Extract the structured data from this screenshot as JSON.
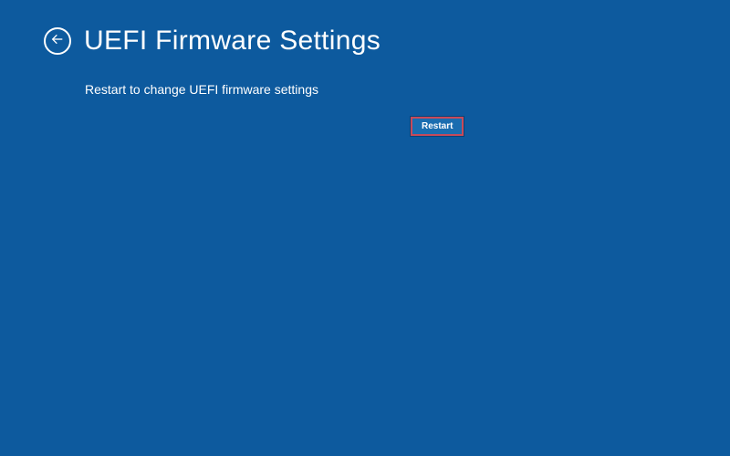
{
  "header": {
    "title": "UEFI Firmware Settings"
  },
  "main": {
    "description": "Restart to change UEFI firmware settings",
    "restart_label": "Restart"
  }
}
